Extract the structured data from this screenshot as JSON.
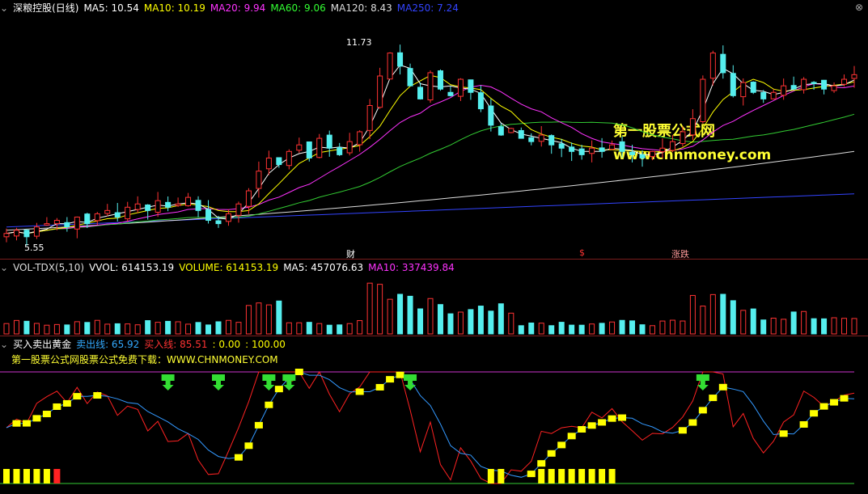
{
  "main": {
    "title": "深粮控股(日线)",
    "ma": [
      {
        "label": "MA5: 10.54",
        "color": "#ffffff"
      },
      {
        "label": "MA10: 10.19",
        "color": "#ffff00"
      },
      {
        "label": "MA20: 9.94",
        "color": "#ff33ff"
      },
      {
        "label": "MA60: 9.06",
        "color": "#33ff33"
      },
      {
        "label": "MA120: 8.43",
        "color": "#dddddd"
      },
      {
        "label": "MA250: 7.24",
        "color": "#3333ff"
      }
    ],
    "high_label": "11.73",
    "low_label": "5.55",
    "events": [
      "财",
      "$",
      "涨跌"
    ],
    "watermark1": "第一股票公式网",
    "watermark2": "www.chnmoney.com"
  },
  "vol": {
    "name": "VOL-TDX(5,10)",
    "vvol": "VVOL: 614153.19",
    "volume": "VOLUME: 614153.19",
    "ma5": "MA5: 457076.63",
    "ma10": "MA10: 337439.84"
  },
  "ind": {
    "name": "买入卖出黄金",
    "sell": "卖出线: 65.92",
    "buy": "买入线: 85.51",
    "zero": ": 0.00",
    "hundred": ": 100.00",
    "promo": "第一股票公式网股票公式免费下载：WWW.CHNMONEY.COM"
  },
  "chart_data": {
    "type": "line",
    "close_series": [
      5.7,
      5.8,
      5.6,
      5.9,
      6.0,
      6.1,
      5.9,
      6.2,
      6.0,
      6.3,
      6.4,
      6.2,
      6.5,
      6.6,
      6.4,
      6.7,
      6.5,
      6.6,
      6.8,
      6.4,
      6.1,
      6.0,
      6.3,
      6.6,
      7.0,
      7.6,
      8.0,
      7.8,
      8.2,
      8.4,
      8.0,
      8.6,
      8.3,
      8.1,
      8.5,
      8.8,
      9.6,
      10.5,
      11.2,
      10.8,
      10.2,
      9.8,
      10.6,
      10.1,
      9.9,
      10.4,
      10.0,
      9.5,
      9.0,
      8.7,
      8.9,
      8.6,
      8.5,
      8.7,
      8.4,
      8.3,
      8.2,
      8.1,
      8.3,
      8.2,
      8.4,
      8.2,
      8.1,
      8.0,
      8.2,
      8.3,
      8.5,
      8.8,
      9.2,
      10.4,
      11.2,
      10.6,
      9.9,
      10.3,
      10.0,
      9.8,
      10.0,
      10.2,
      10.1,
      10.4,
      10.3,
      10.1,
      10.2,
      10.4,
      10.54
    ],
    "low": 5.55,
    "high": 11.73
  }
}
